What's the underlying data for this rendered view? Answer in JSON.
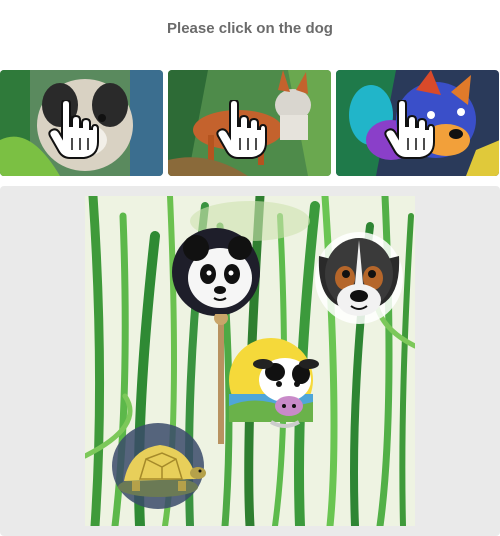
{
  "prompt": {
    "text": "Please click on the dog"
  },
  "thumbnails": [
    {
      "subject": "small-dog",
      "icon": "pointer-hand-icon"
    },
    {
      "subject": "brown-dog",
      "icon": "pointer-hand-icon"
    },
    {
      "subject": "colorful-dog",
      "icon": "pointer-hand-icon"
    }
  ],
  "canvas": {
    "background": "green-grass-watercolor",
    "animals": [
      "panda",
      "dog",
      "cow",
      "turtle"
    ]
  },
  "colors": {
    "prompt_text": "#6b6b6b",
    "panel_bg": "#eaeaea",
    "grass": "#3f9a3a"
  }
}
